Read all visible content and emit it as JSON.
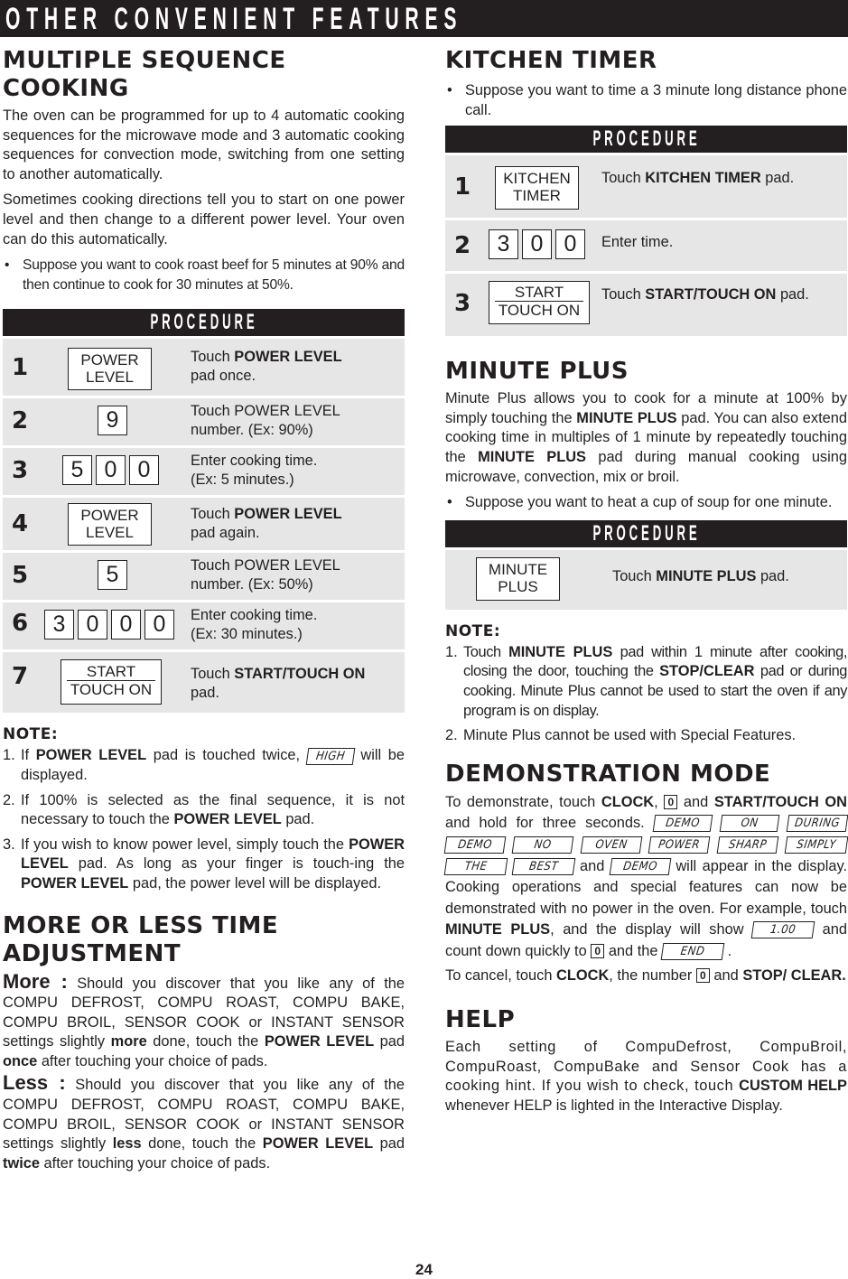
{
  "banner": {
    "title": "OTHER CONVENIENT FEATURES"
  },
  "multiple_sequence": {
    "heading_line1": "MULTIPLE SEQUENCE",
    "heading_line2": "COOKING",
    "para1": "The oven can be programmed for up to 4 automatic cooking sequences for the microwave mode and 3 automatic cooking sequences for convection mode, switching from one setting to another automatically.",
    "para2": "Sometimes cooking directions tell you to start on one power level and then change to a different power level. Your oven can do this automatically.",
    "bullet": "Suppose you want to cook roast beef for 5 minutes at 90% and then continue to cook for 30 minutes at 50%.",
    "procedure_label": "PROCEDURE",
    "steps": [
      {
        "num": "1",
        "pad": [
          "POWER",
          "LEVEL"
        ],
        "desc_pre": "Touch ",
        "desc_bold": "POWER LEVEL",
        "desc_post": "pad once."
      },
      {
        "num": "2",
        "digits": [
          "9"
        ],
        "desc_line1": "Touch POWER LEVEL",
        "desc_line2": "number. (Ex: 90%)"
      },
      {
        "num": "3",
        "digits": [
          "5",
          "0",
          "0"
        ],
        "desc_line1": "Enter cooking time.",
        "desc_line2": "(Ex: 5 minutes.)"
      },
      {
        "num": "4",
        "pad": [
          "POWER",
          "LEVEL"
        ],
        "desc_pre": "Touch ",
        "desc_bold": "POWER LEVEL",
        "desc_post": "pad again."
      },
      {
        "num": "5",
        "digits": [
          "5"
        ],
        "desc_line1": "Touch POWER LEVEL",
        "desc_line2": "number. (Ex: 50%)"
      },
      {
        "num": "6",
        "digits": [
          "3",
          "0",
          "0",
          "0"
        ],
        "desc_line1": "Enter cooking time.",
        "desc_line2": "(Ex: 30 minutes.)"
      },
      {
        "num": "7",
        "pad": [
          "START",
          "TOUCH ON"
        ],
        "desc_pre": "Touch ",
        "desc_bold": "START/TOUCH ON",
        "desc_post": "pad."
      }
    ],
    "note_heading": "NOTE:",
    "notes": [
      {
        "num": "1.",
        "a": "If ",
        "b": "POWER LEVEL",
        "c": " pad is touched twice, ",
        "lcd": "HIGH",
        "d": " will be displayed."
      },
      {
        "num": "2.",
        "a": "If 100% is selected as the final sequence, it is not necessary to touch the ",
        "b": "POWER LEVEL",
        "c": " pad."
      },
      {
        "num": "3.",
        "a": "If you wish to know power level, simply touch the ",
        "b": "POWER LEVEL",
        "c": " pad. As long as your finger is touch-ing the ",
        "d": "POWER LEVEL",
        "e": " pad, the power level will be displayed."
      }
    ]
  },
  "more_less": {
    "heading_line1": "MORE OR LESS TIME",
    "heading_line2": "ADJUSTMENT",
    "more_label": "More :",
    "more_a": " Should you discover that you like any of the COMPU DEFROST, COMPU ROAST, COMPU BAKE, COMPU BROIL, SENSOR COOK or INSTANT SENSOR settings slightly ",
    "more_b": "more",
    "more_c": " done, touch the ",
    "more_d": "POWER LEVEL",
    "more_e": " pad ",
    "more_f": "once",
    "more_g": " after touching your choice of pads.",
    "less_label": "Less :",
    "less_a": " Should you discover that you like any of the COMPU DEFROST, COMPU ROAST, COMPU BAKE, COMPU BROIL, SENSOR COOK or INSTANT SENSOR settings slightly ",
    "less_b": "less",
    "less_c": " done, touch the ",
    "less_d": "POWER LEVEL",
    "less_e": " pad ",
    "less_f": "twice",
    "less_g": " after touching your choice of pads."
  },
  "kitchen_timer": {
    "heading": "KITCHEN TIMER",
    "bullet": "Suppose you want to time a 3 minute long distance phone call.",
    "procedure_label": "PROCEDURE",
    "steps": [
      {
        "num": "1",
        "pad": [
          "KITCHEN",
          "TIMER"
        ],
        "desc_pre": "Touch ",
        "desc_bold": "KITCHEN TIMER",
        "desc_post": " pad."
      },
      {
        "num": "2",
        "digits": [
          "3",
          "0",
          "0"
        ],
        "desc": "Enter time."
      },
      {
        "num": "3",
        "pad": [
          "START",
          "TOUCH ON"
        ],
        "desc_pre": "Touch ",
        "desc_bold": "START/TOUCH ON",
        "desc_post": " pad."
      }
    ]
  },
  "minute_plus": {
    "heading": "MINUTE PLUS",
    "para_a": "Minute Plus allows you to cook for a minute at 100% by simply touching the ",
    "para_b": "MINUTE PLUS",
    "para_c": " pad. You can also extend cooking time in multiples of 1 minute by repeatedly touching the ",
    "para_d": "MINUTE PLUS",
    "para_e": " pad during manual cooking using microwave, convection, mix or broil.",
    "bullet": "Suppose you want to heat a cup of soup for one minute.",
    "procedure_label": "PROCEDURE",
    "step": {
      "pad": [
        "MINUTE",
        "PLUS"
      ],
      "desc_pre": "Touch ",
      "desc_bold": "MINUTE PLUS",
      "desc_post": " pad."
    },
    "note_heading": "NOTE:",
    "notes": [
      {
        "num": "1.",
        "a": "Touch ",
        "b": "MINUTE PLUS",
        "c": " pad within 1 minute after cooking, closing the door, touching the ",
        "d": "STOP/CLEAR",
        "e": " pad or during cooking. Minute Plus cannot be used to start the oven if any program is on display."
      },
      {
        "num": "2.",
        "a": "Minute Plus cannot be used with Special Features."
      }
    ]
  },
  "demo_mode": {
    "heading": "DEMONSTRATION MODE",
    "p1_a": "To demonstrate, touch ",
    "p1_b": "CLOCK",
    "p1_c": ", ",
    "key_zero": "0",
    "p1_d": " and ",
    "p1_e": "START/TOUCH ON",
    "p1_f": " and hold for three seconds. ",
    "display_words": [
      "DEMO",
      "ON",
      "DURING",
      "DEMO",
      "NO",
      "OVEN",
      "POWER",
      "SHARP",
      "SIMPLY",
      "THE",
      "BEST"
    ],
    "and_word": " and ",
    "final_word": "DEMO",
    "p1_g": " will appear in the display. Cooking operations and special features can now be demonstrated with no power in the oven. For example, touch ",
    "p1_h": "MINUTE PLUS",
    "p1_i": ", and the display will show ",
    "lcd_time": "1.00",
    "p1_j": " and count down quickly to ",
    "p1_k": " and the ",
    "lcd_end": "END",
    "p1_l": " .",
    "p2_a": "To cancel, touch ",
    "p2_b": "CLOCK",
    "p2_c": ", the number ",
    "p2_d": " and ",
    "p2_e": "STOP/ CLEAR."
  },
  "help": {
    "heading": "HELP",
    "p_a": "Each setting of CompuDefrost, CompuBroil, CompuRoast, CompuBake and Sensor Cook has a cooking hint. If you wish to check, touch ",
    "p_b": "CUSTOM HELP",
    "p_c": " whenever HELP is lighted in the Interactive Display."
  },
  "page_number": "24"
}
